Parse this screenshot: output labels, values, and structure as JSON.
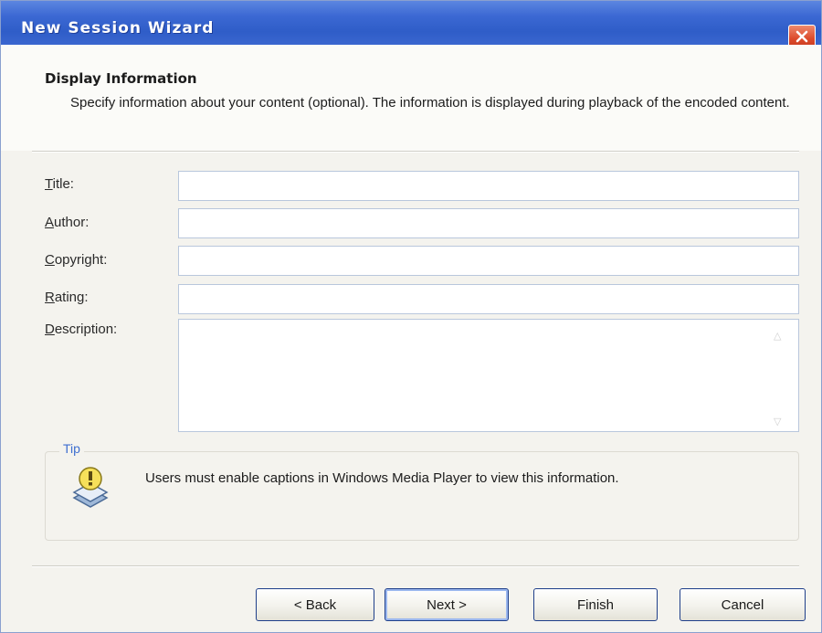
{
  "window": {
    "title": "New Session Wizard",
    "close_icon": "close-icon"
  },
  "header": {
    "title": "Display Information",
    "description": "Specify information about your content (optional). The information is displayed during playback of the encoded content."
  },
  "fields": {
    "title_label": "Title:",
    "title_value": "",
    "author_label": "Author:",
    "author_value": "",
    "copyright_label": "Copyright:",
    "copyright_value": "",
    "rating_label": "Rating:",
    "rating_value": "",
    "description_label": "Description:",
    "description_value": ""
  },
  "tip": {
    "legend": "Tip",
    "icon": "caption-tip-icon",
    "text": "Users must enable captions in Windows Media Player to view this information."
  },
  "buttons": {
    "back_label": "< Back",
    "next_label": "Next >",
    "finish_label": "Finish",
    "cancel_label": "Cancel"
  },
  "colors": {
    "titlebar": "#3b68d3",
    "close_button": "#dc4b2c",
    "tip_legend": "#3f6fd0",
    "dialog_face": "#f4f3ee"
  }
}
